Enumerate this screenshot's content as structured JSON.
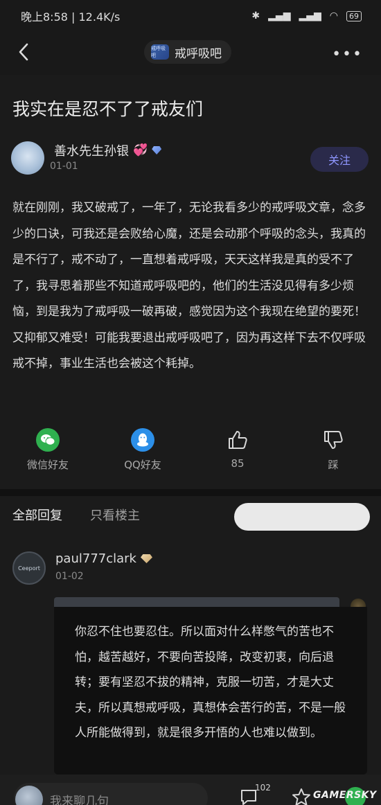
{
  "status_bar": {
    "time": "晚上8:58 | 12.4K/s",
    "battery": "69"
  },
  "nav": {
    "forum_logo_text": "戒呼吸吧",
    "forum_name": "戒呼吸吧",
    "more": "•••"
  },
  "post": {
    "title": "我实在是忍不了了戒友们",
    "author": "善水先生孙银",
    "date": "01-01",
    "follow_label": "关注",
    "content": "就在刚刚，我又破戒了，一年了，无论我看多少的戒呼吸文章，念多少的口诀，可我还是会败给心魔，还是会动那个呼吸的念头，我真的是不行了，戒不动了，一直想着戒呼吸，天天这样我是真的受不了了，我寻思着那些不知道戒呼吸吧的，他们的生活没见得有多少烦恼，到是我为了戒呼吸一破再破，感觉因为这个我现在绝望的要死！又抑郁又难受！可能我要退出戒呼吸吧了，因为再这样下去不仅呼吸戒不掉，事业生活也会被这个耗掉。",
    "actions": [
      {
        "label": "微信好友",
        "icon": "wechat-icon"
      },
      {
        "label": "QQ好友",
        "icon": "qq-icon"
      },
      {
        "label": "85",
        "icon": "thumbs-up-icon"
      },
      {
        "label": "踩",
        "icon": "thumbs-down-icon"
      }
    ]
  },
  "tabs": {
    "all": "全部回复",
    "op_only": "只看楼主"
  },
  "reply": {
    "avatar_text": "Ceeport",
    "username": "paul777clark",
    "date": "01-02",
    "content": "你忍不住也要忍住。所以面对什么样憋气的苦也不怕，越苦越好，不要向苦投降，改变初衷，向后退转；要有坚忍不拔的精神，克服一切苦，才是大丈夫，所以真想戒呼吸，真想体会苦行的苦，不是一般人所能做得到，就是很多开悟的人也难以做到。"
  },
  "bottom_bar": {
    "input_placeholder": "我来聊几句",
    "comment_count": "102"
  },
  "watermark": "GAMERSKY",
  "colors": {
    "background": "#141414",
    "accent": "#8f97ff",
    "wechat": "#2fb04f",
    "qq": "#2c8fe8"
  }
}
